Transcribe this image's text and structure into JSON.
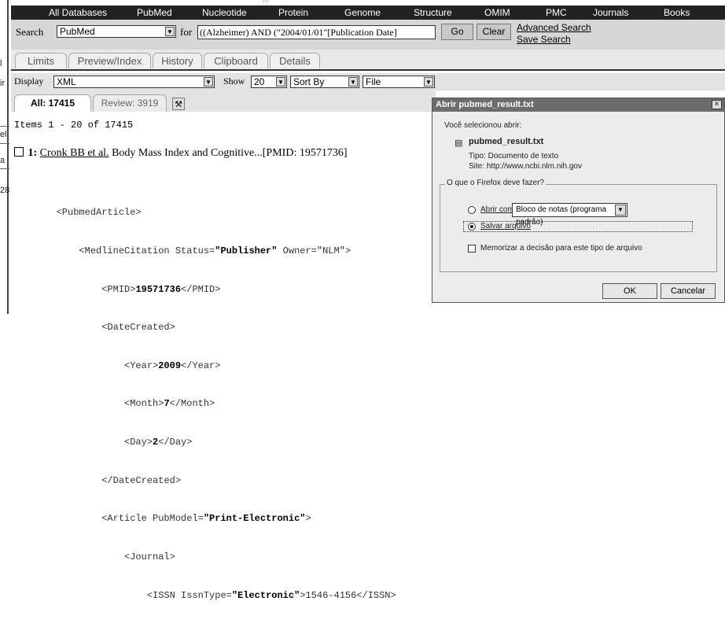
{
  "left_fragments": [
    "l",
    "ir",
    "el",
    "a",
    "k",
    "28"
  ],
  "top_fragment": "...",
  "navbar": {
    "items": [
      "All Databases",
      "PubMed",
      "Nucleotide",
      "Protein",
      "Genome",
      "Structure",
      "OMIM",
      "PMC",
      "Journals",
      "Books"
    ]
  },
  "search": {
    "search_label": "Search",
    "db_value": "PubMed",
    "for_label": "for",
    "term_value": "((Alzheimer) AND (\"2004/01/01\"[Publication Date]",
    "go_label": "Go",
    "clear_label": "Clear",
    "advanced_link": "Advanced Search",
    "save_link": "Save Search"
  },
  "tabs": [
    "Limits",
    "Preview/Index",
    "History",
    "Clipboard",
    "Details"
  ],
  "display": {
    "display_label": "Display",
    "format_value": "XML",
    "show_label": "Show",
    "show_value": "20",
    "sort_value": "Sort By",
    "send_value": "File"
  },
  "results_tabs": {
    "all_label": "All: 17415",
    "review_label": "Review: 3919"
  },
  "items_text": "Items 1 - 20 of 17415",
  "result": {
    "number": "1:",
    "authors": "Cronk BB et al.",
    "title": " Body Mass Index and Cognitive...[PMID: 19571736]"
  },
  "xml_lines": [
    {
      "pre": "        <PubmedArticle>",
      "bold": "",
      "post": ""
    },
    {
      "pre": "            <MedlineCitation Status=",
      "bold": "\"Publisher\"",
      "post": " Owner=\"NLM\">"
    },
    {
      "pre": "                <PMID>",
      "bold": "19571736",
      "post": "</PMID>"
    },
    {
      "pre": "                <DateCreated>",
      "bold": "",
      "post": ""
    },
    {
      "pre": "                    <Year>",
      "bold": "2009",
      "post": "</Year>"
    },
    {
      "pre": "                    <Month>",
      "bold": "7",
      "post": "</Month>"
    },
    {
      "pre": "                    <Day>",
      "bold": "2",
      "post": "</Day>"
    },
    {
      "pre": "                </DateCreated>",
      "bold": "",
      "post": ""
    },
    {
      "pre": "                <Article PubModel=",
      "bold": "\"Print-Electronic\"",
      "post": ">"
    },
    {
      "pre": "                    <Journal>",
      "bold": "",
      "post": ""
    },
    {
      "pre": "                        <ISSN IssnType=",
      "bold": "\"Electronic\"",
      "post": ">1546-4156</ISSN>"
    }
  ],
  "dialog": {
    "title": "Abrir pubmed_result.txt",
    "close": "×",
    "intro": "Você selecionou abrir:",
    "filename": "pubmed_result.txt",
    "type_line": "Tipo:  Documento de texto",
    "site_line": "Site: http://www.ncbi.nlm.nih.gov",
    "group_label": "O que o Firefox deve fazer?",
    "open_with_label": "Abrir com:",
    "open_with_value": "Bloco de notas (programa padrão)",
    "save_label": "Salvar arquivo",
    "remember_label": "Memorizar a decisão para este tipo de arquivo",
    "ok_label": "OK",
    "cancel_label": "Cancelar"
  }
}
